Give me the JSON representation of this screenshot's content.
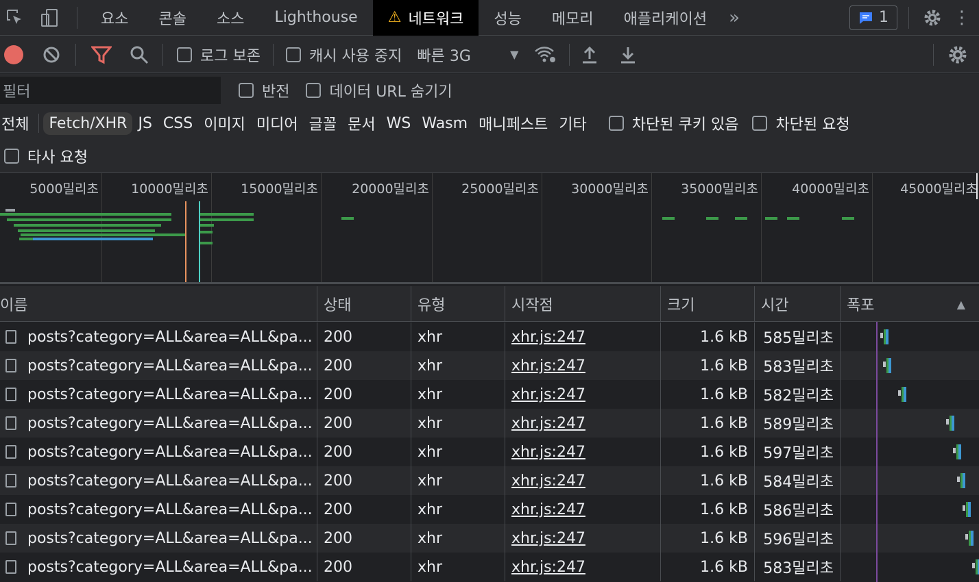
{
  "tabs": [
    "요소",
    "콘솔",
    "소스",
    "Lighthouse",
    "네트워크",
    "성능",
    "메모리",
    "애플리케이션"
  ],
  "active_tab": "네트워크",
  "issues_count": "1",
  "toolbar": {
    "preserve_log": "로그 보존",
    "disable_cache": "캐시 사용 중지",
    "throttling": "빠른 3G"
  },
  "filter": {
    "placeholder": "필터",
    "invert": "반전",
    "hide_data_urls": "데이터 URL 숨기기"
  },
  "type_filters": [
    "전체",
    "Fetch/XHR",
    "JS",
    "CSS",
    "이미지",
    "미디어",
    "글꼴",
    "문서",
    "WS",
    "Wasm",
    "매니페스트",
    "기타"
  ],
  "selected_type": "Fetch/XHR",
  "blocked_cookies": "차단된 쿠키 있음",
  "blocked_requests": "차단된 요청",
  "third_party": "타사 요청",
  "overview_ticks": [
    "5000밀리초",
    "10000밀리초",
    "15000밀리초",
    "20000밀리초",
    "25000밀리초",
    "30000밀리초",
    "35000밀리초",
    "40000밀리초",
    "45000밀리초"
  ],
  "columns": [
    "이름",
    "상태",
    "유형",
    "시작점",
    "크기",
    "시간",
    "폭포"
  ],
  "rows": [
    {
      "name": "posts?category=ALL&area=ALL&pa...",
      "status": "200",
      "type": "xhr",
      "initiator": "xhr.js:247",
      "size": "1.6 kB",
      "time": "585밀리초"
    },
    {
      "name": "posts?category=ALL&area=ALL&pa...",
      "status": "200",
      "type": "xhr",
      "initiator": "xhr.js:247",
      "size": "1.6 kB",
      "time": "583밀리초"
    },
    {
      "name": "posts?category=ALL&area=ALL&pa...",
      "status": "200",
      "type": "xhr",
      "initiator": "xhr.js:247",
      "size": "1.6 kB",
      "time": "582밀리초"
    },
    {
      "name": "posts?category=ALL&area=ALL&pa...",
      "status": "200",
      "type": "xhr",
      "initiator": "xhr.js:247",
      "size": "1.6 kB",
      "time": "589밀리초"
    },
    {
      "name": "posts?category=ALL&area=ALL&pa...",
      "status": "200",
      "type": "xhr",
      "initiator": "xhr.js:247",
      "size": "1.6 kB",
      "time": "597밀리초"
    },
    {
      "name": "posts?category=ALL&area=ALL&pa...",
      "status": "200",
      "type": "xhr",
      "initiator": "xhr.js:247",
      "size": "1.6 kB",
      "time": "584밀리초"
    },
    {
      "name": "posts?category=ALL&area=ALL&pa...",
      "status": "200",
      "type": "xhr",
      "initiator": "xhr.js:247",
      "size": "1.6 kB",
      "time": "586밀리초"
    },
    {
      "name": "posts?category=ALL&area=ALL&pa...",
      "status": "200",
      "type": "xhr",
      "initiator": "xhr.js:247",
      "size": "1.6 kB",
      "time": "596밀리초"
    },
    {
      "name": "posts?category=ALL&area=ALL&pa...",
      "status": "200",
      "type": "xhr",
      "initiator": "xhr.js:247",
      "size": "1.6 kB",
      "time": "583밀리초"
    }
  ]
}
